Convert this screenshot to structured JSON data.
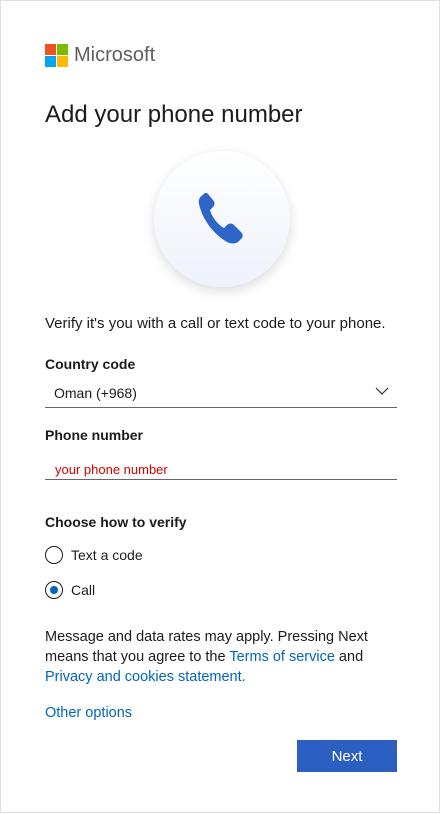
{
  "brand": {
    "name": "Microsoft",
    "colors": [
      "#f25022",
      "#7fba00",
      "#00a4ef",
      "#ffb900"
    ]
  },
  "page": {
    "title": "Add your phone number",
    "intro": "Verify it's you with a call or text code to your phone.",
    "icon": "phone-icon"
  },
  "country": {
    "label": "Country code",
    "value": "Oman (+968)"
  },
  "phone": {
    "label": "Phone number",
    "placeholder": "your phone number",
    "value": ""
  },
  "verify": {
    "label": "Choose how to verify",
    "options": [
      {
        "label": "Text a code",
        "checked": false
      },
      {
        "label": "Call",
        "checked": true
      }
    ]
  },
  "legal": {
    "text_before": "Message and data rates may apply. Pressing Next means that you agree to the ",
    "terms_link": "Terms of service",
    "text_middle": " and ",
    "privacy_link": "Privacy and cookies statement."
  },
  "other_options": "Other options",
  "next_button": "Next",
  "theme": {
    "accent": "#0067b8",
    "button": "#2b5fc1",
    "placeholder_color": "#d40000"
  }
}
